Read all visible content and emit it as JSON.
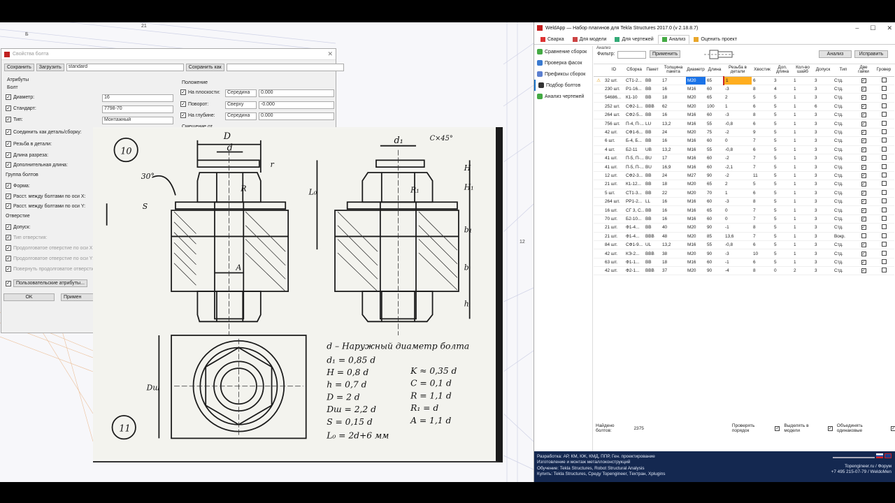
{
  "bolt_dialog": {
    "title": "Свойства болта",
    "save": "Сохранить",
    "load": "Загрузить",
    "preset": "standard",
    "save_as": "Сохранить как",
    "section_attr": "Атрибуты",
    "section_bolt": "Болт",
    "diameter_label": "Диаметр:",
    "diameter": "16",
    "standard_label": "Стандарт:",
    "standard": "7798-70",
    "type_label": "Тип:",
    "type": "Монтажный",
    "connect_label": "Соединить как деталь/сборку:",
    "thread_label": "Резьба в детали:",
    "cut_label": "Длина разреза:",
    "extra_label": "Дополнительная длина:",
    "group_label": "Группа болтов",
    "shape_label": "Форма:",
    "dist_x_label": "Расст. между болтами по оси X:",
    "dist_y_label": "Расст. между болтами по оси Y:",
    "hole_label": "Отверстие",
    "tolerance_label": "Допуск:",
    "hole_type_label": "Тип отверстия:",
    "slot_x_label": "Продолговатое отверстие по оси X:",
    "slot_y_label": "Продолговатое отверстие по оси Y:",
    "rotate_label": "Повернуть продолговатое отверстие",
    "user_attr": "Пользовательские атрибуты...",
    "ok": "OK",
    "apply": "Примен",
    "pos_title": "Положение",
    "plane_label": "На плоскости:",
    "plane_sel": "Середина",
    "plane_val": "0.000",
    "rot_label": "Поворот:",
    "rot_sel": "Сверху",
    "rot_val": "-0.000",
    "depth_label": "На глубине:",
    "depth_sel": "Середина",
    "depth_val": "0.000",
    "offset_label": "Смещение от"
  },
  "drawing": {
    "fig10": "10",
    "fig11": "11",
    "dim_D": "D",
    "dim_d": "d",
    "dim_d1": "d₁",
    "dim_c": "C×45°",
    "dim_H": "H",
    "dim_H1": "H₁",
    "dim_30": "30°",
    "dim_r": "r",
    "dim_R": "R",
    "dim_R1": "R₁",
    "dim_S": "S",
    "dim_L0": "L₀",
    "dim_A": "A",
    "dim_b1": "b₁",
    "dim_b": "b",
    "dim_h": "h",
    "dim_Dsh": "Dш",
    "legend": [
      "d – Наружный диаметр болта",
      "d₁ = 0,85 d",
      "K ≈ 0,35 d",
      "H = 0,8 d",
      "C = 0,1 d",
      "h = 0,7 d",
      "R = 1,1 d",
      "D = 2 d",
      "R₁ = d",
      "Dш = 2,2 d",
      "A = 1,1 d",
      "S = 0,15 d",
      "L₀ = 2d+6 мм"
    ]
  },
  "app": {
    "title": "WeldApp — Набор плагинов для Tekla Structures 2017.0 (v 2.18.8.7)",
    "tabs": [
      "Сварка",
      "Для модели",
      "Для чертежей",
      "Анализ",
      "Оценить проект"
    ],
    "side": [
      "Сравнение сборок",
      "Проверка фасок",
      "Префиксы сборок",
      "Подбор болтов",
      "Анализ чертежей"
    ],
    "analiz_label": "Анализ",
    "filter_label": "Фильтр:",
    "apply": "Применить",
    "analyze": "Анализ",
    "fix": "Исправить",
    "columns": [
      "ID",
      "Сборка",
      "Пакет",
      "Толщина пакета",
      "Диаметр",
      "Длина",
      "Резьба в детали",
      "Хвостик",
      "Доп. длина",
      "Кол-во шайб",
      "Допуск",
      "Тип",
      "Две гайки",
      "Гровер"
    ],
    "rows": [
      [
        "32 шт.",
        "СТ1-2...",
        "BB",
        "17",
        "M20",
        "65",
        "1",
        "6",
        "3",
        "1",
        "3",
        "Стд.",
        "1",
        "0"
      ],
      [
        "230 шт.",
        "Р1-16...",
        "BB",
        "16",
        "M16",
        "60",
        "-3",
        "8",
        "4",
        "1",
        "3",
        "Стд.",
        "1",
        "0"
      ],
      [
        "54686...",
        "К1-10",
        "BB",
        "18",
        "M20",
        "65",
        "2",
        "5",
        "5",
        "1",
        "3",
        "Стд.",
        "1",
        "0"
      ],
      [
        "252 шт.",
        "СФ2-1...",
        "BBB",
        "62",
        "M20",
        "100",
        "1",
        "6",
        "5",
        "1",
        "6",
        "Стд.",
        "1",
        "0"
      ],
      [
        "264 шт.",
        "СФ2-5...",
        "BB",
        "16",
        "M16",
        "60",
        "-3",
        "8",
        "5",
        "1",
        "3",
        "Стд.",
        "1",
        "0"
      ],
      [
        "756 шт.",
        "П-4, П-...",
        "LU",
        "13,2",
        "M16",
        "55",
        "-0,8",
        "6",
        "5",
        "1",
        "3",
        "Стд.",
        "1",
        "0"
      ],
      [
        "42 шт.",
        "СФ1-6...",
        "BB",
        "24",
        "M20",
        "75",
        "-2",
        "9",
        "5",
        "1",
        "3",
        "Стд.",
        "1",
        "0"
      ],
      [
        "6 шт.",
        "Б-4, Б...",
        "BB",
        "16",
        "M16",
        "60",
        "0",
        "7",
        "5",
        "1",
        "3",
        "Стд.",
        "1",
        "0"
      ],
      [
        "4 шт.",
        "Б2-11",
        "UB",
        "13,2",
        "M16",
        "55",
        "-0,8",
        "6",
        "5",
        "1",
        "3",
        "Стд.",
        "1",
        "0"
      ],
      [
        "41 шт.",
        "П-5, П-...",
        "BU",
        "17",
        "M16",
        "60",
        "-2",
        "7",
        "5",
        "1",
        "3",
        "Стд.",
        "1",
        "0"
      ],
      [
        "41 шт.",
        "П-5, П-...",
        "BU",
        "16,9",
        "M16",
        "60",
        "-2,1",
        "7",
        "5",
        "1",
        "3",
        "Стд.",
        "1",
        "0"
      ],
      [
        "12 шт.",
        "СФ2-3...",
        "BB",
        "24",
        "M27",
        "90",
        "-2",
        "11",
        "5",
        "1",
        "3",
        "Стд.",
        "1",
        "0"
      ],
      [
        "21 шт.",
        "К1-12...",
        "BB",
        "18",
        "M20",
        "65",
        "2",
        "5",
        "5",
        "1",
        "3",
        "Стд.",
        "1",
        "0"
      ],
      [
        "5 шт.",
        "СТ1-3...",
        "BB",
        "22",
        "M20",
        "70",
        "1",
        "6",
        "5",
        "1",
        "3",
        "Стд.",
        "1",
        "0"
      ],
      [
        "264 шт.",
        "РР1-2...",
        "LL",
        "16",
        "M16",
        "60",
        "-3",
        "8",
        "5",
        "1",
        "3",
        "Стд.",
        "1",
        "0"
      ],
      [
        "16 шт.",
        "СГ 3, С...",
        "BB",
        "16",
        "M16",
        "65",
        "0",
        "7",
        "5",
        "1",
        "3",
        "Стд.",
        "1",
        "0"
      ],
      [
        "70 шт.",
        "Б2-10...",
        "BB",
        "16",
        "M16",
        "60",
        "0",
        "7",
        "5",
        "1",
        "3",
        "Стд.",
        "1",
        "0"
      ],
      [
        "21 шт.",
        "Ф1-4...",
        "BB",
        "40",
        "M20",
        "90",
        "-1",
        "8",
        "5",
        "1",
        "3",
        "Стд.",
        "1",
        "0"
      ],
      [
        "21 шт.",
        "Ф1-4...",
        "BBB",
        "48",
        "M20",
        "85",
        "13,6",
        "7",
        "5",
        "1",
        "3",
        "Вокр.",
        "0",
        "0"
      ],
      [
        "84 шт.",
        "СФ1-9...",
        "UL",
        "13,2",
        "M16",
        "55",
        "-0,8",
        "6",
        "5",
        "1",
        "3",
        "Стд.",
        "1",
        "0"
      ],
      [
        "42 шт.",
        "КЭ-2...",
        "BBB",
        "38",
        "M20",
        "90",
        "-3",
        "10",
        "5",
        "1",
        "3",
        "Стд.",
        "1",
        "0"
      ],
      [
        "63 шт.",
        "Ф1-1...",
        "BB",
        "18",
        "M16",
        "60",
        "-1",
        "6",
        "5",
        "1",
        "3",
        "Стд.",
        "1",
        "0"
      ],
      [
        "42 шт.",
        "Ф2-1...",
        "BBB",
        "37",
        "M20",
        "90",
        "-4",
        "8",
        "0",
        "2",
        "3",
        "Стд.",
        "1",
        "0"
      ]
    ],
    "found_label": "Найдено болтов:",
    "found": "2375",
    "check_order": "Проверять порядок",
    "select_model": "Выделять в модели",
    "merge_same": "Объединять одинаковые",
    "footer": [
      "Разработка: АР, КМ, КЖ, КМД, ППР, Ген. проектирование",
      "Изготовление и монтаж металлоконструкций",
      "Обучение: Tekla Structures, Robot Structural Analysis",
      "Купить: Tekla Structures, Среду Topengineer, Техтран, Xplugins"
    ],
    "footer_right": [
      "Topengineer.ru / Форум",
      "+7 495 215-07-79 / WeldoMen"
    ]
  },
  "cad_labels": [
    "Б",
    "21",
    "12"
  ]
}
